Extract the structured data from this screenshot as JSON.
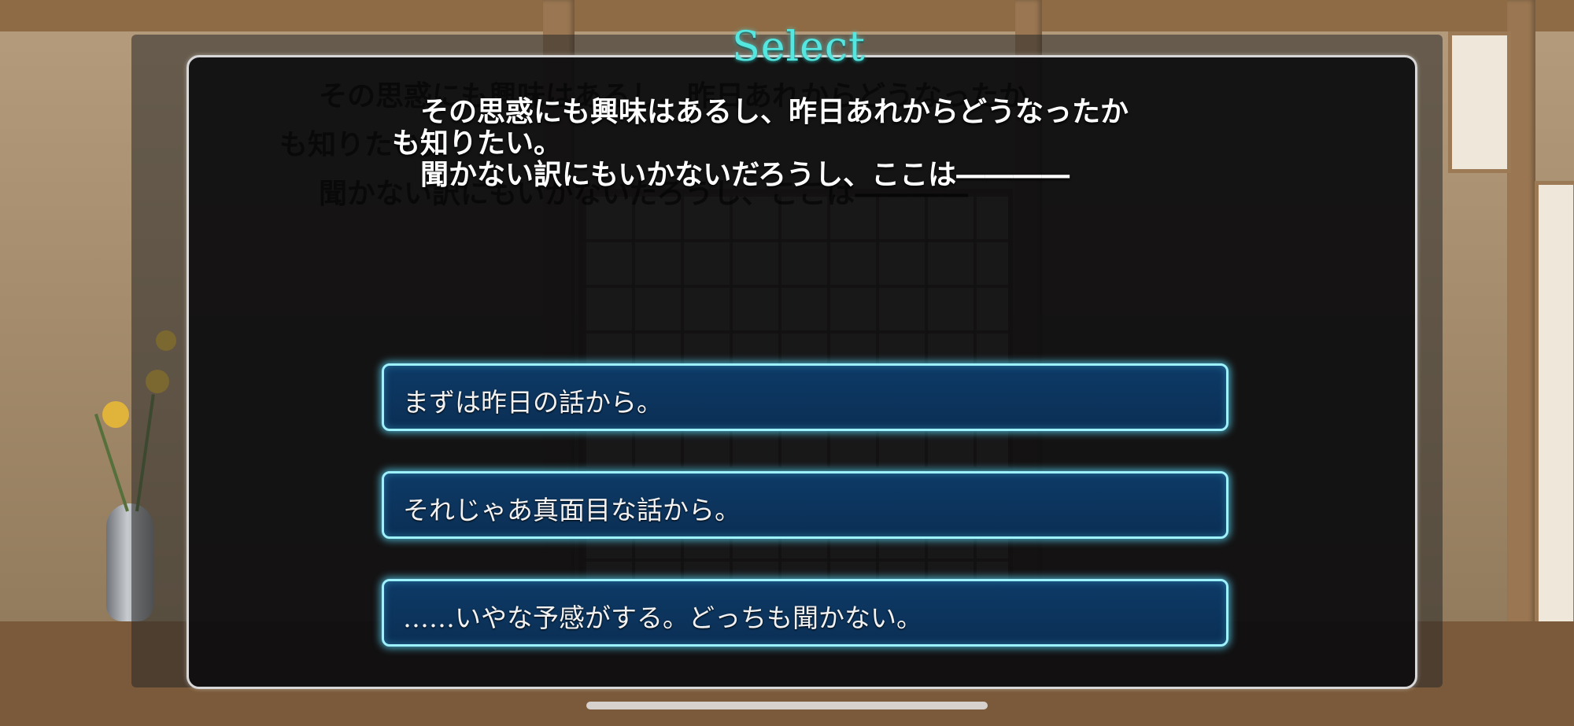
{
  "dialog": {
    "title": "Select",
    "message_lines": [
      "　その思惑にも興味はあるし、昨日あれからどうなったか",
      "も知りたい。",
      "　聞かない訳にもいかないだろうし、ここは――――"
    ],
    "ghost_lines": [
      "その思惑にも興味はあるし、昨日あれからどうなったか",
      "も知りたい。",
      "聞かない訳にもいかないだろうし、ここは――――"
    ]
  },
  "choices": [
    {
      "label": "まずは昨日の話から。"
    },
    {
      "label": "それじゃあ真面目な話から。"
    },
    {
      "label": "……いやな予感がする。どっちも聞かない。"
    }
  ],
  "colors": {
    "title": "#55e6e0",
    "choice_border": "#9ef2ff",
    "choice_fill": "#0d3a66"
  }
}
